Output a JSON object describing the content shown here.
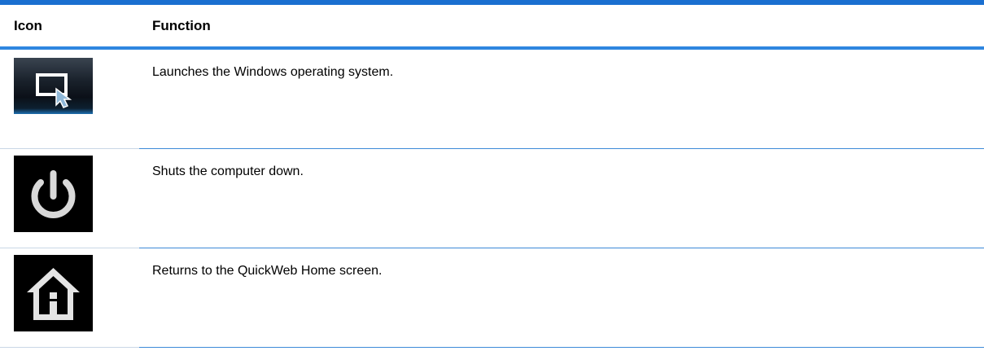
{
  "table": {
    "headers": {
      "icon": "Icon",
      "function": "Function"
    },
    "rows": [
      {
        "icon": "windows-launch-icon",
        "function": "Launches the Windows operating system."
      },
      {
        "icon": "power-icon",
        "function": "Shuts the computer down."
      },
      {
        "icon": "home-icon",
        "function": "Returns to the QuickWeb Home screen."
      }
    ]
  },
  "colors": {
    "rule_dark": "#1a6fd0",
    "rule_light": "#2f86e0",
    "row_divider": "#3d8ad8"
  }
}
